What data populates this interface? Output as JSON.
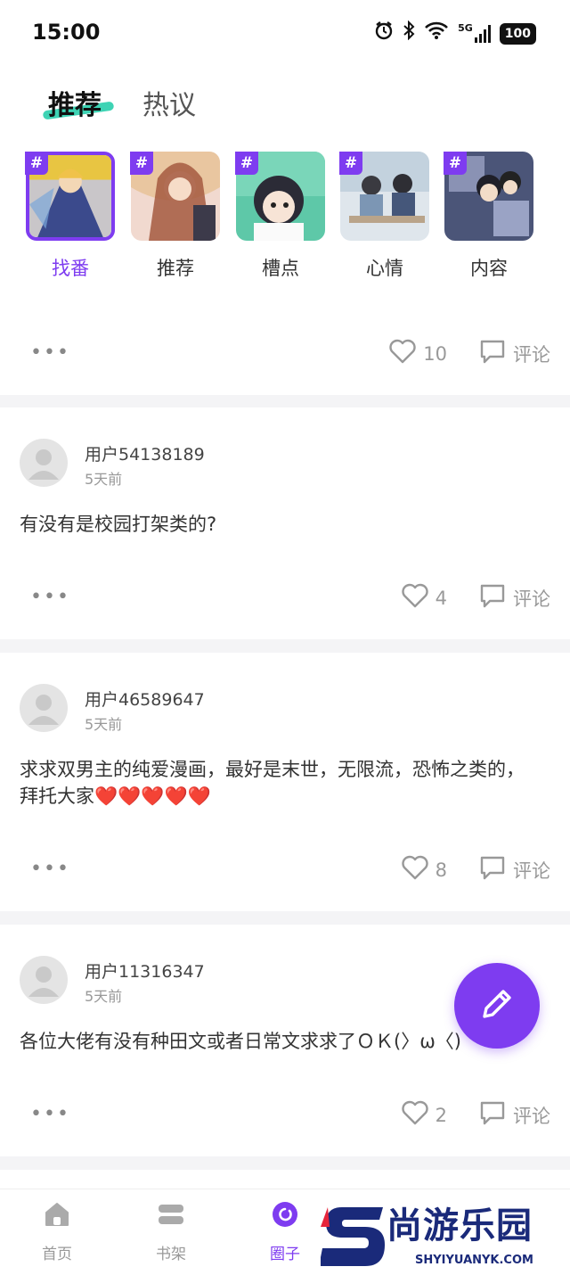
{
  "status_bar": {
    "time": "15:00",
    "network": "5G",
    "battery": "100"
  },
  "tabs": [
    {
      "label": "推荐",
      "active": true
    },
    {
      "label": "热议",
      "active": false
    }
  ],
  "categories": [
    {
      "label": "找番",
      "tag": "#",
      "active": true
    },
    {
      "label": "推荐",
      "tag": "#",
      "active": false
    },
    {
      "label": "槽点",
      "tag": "#",
      "active": false
    },
    {
      "label": "心情",
      "tag": "#",
      "active": false
    },
    {
      "label": "内容",
      "tag": "#",
      "active": false
    }
  ],
  "top_actions": {
    "more": "•••",
    "likes": "10",
    "comment_label": "评论"
  },
  "posts": [
    {
      "username": "用户54138189",
      "time": "5天前",
      "text": "有没有是校园打架类的?",
      "likes": "4",
      "comment_label": "评论",
      "more": "•••"
    },
    {
      "username": "用户46589647",
      "time": "5天前",
      "text": "求求双男主的纯爱漫画，最好是末世，无限流，恐怖之类的，拜托大家❤️❤️❤️❤️❤️",
      "likes": "8",
      "comment_label": "评论",
      "more": "•••"
    },
    {
      "username": "用户11316347",
      "time": "5天前",
      "text": "各位大佬有没有种田文或者日常文求求了ＯＫ(〉ω〈)",
      "likes": "2",
      "comment_label": "评论",
      "more": "•••"
    }
  ],
  "bottom_nav": [
    {
      "label": "首页",
      "icon": "home-icon",
      "active": false
    },
    {
      "label": "书架",
      "icon": "bookshelf-icon",
      "active": false
    },
    {
      "label": "圈子",
      "icon": "circle-icon",
      "active": true
    }
  ],
  "watermark": {
    "text": "尚游乐园",
    "sub": "SHYIYUANYK.COM"
  },
  "colors": {
    "accent": "#7e3cf0",
    "tab_underline": "#3ed3b4",
    "watermark": "#1a2a7a"
  }
}
